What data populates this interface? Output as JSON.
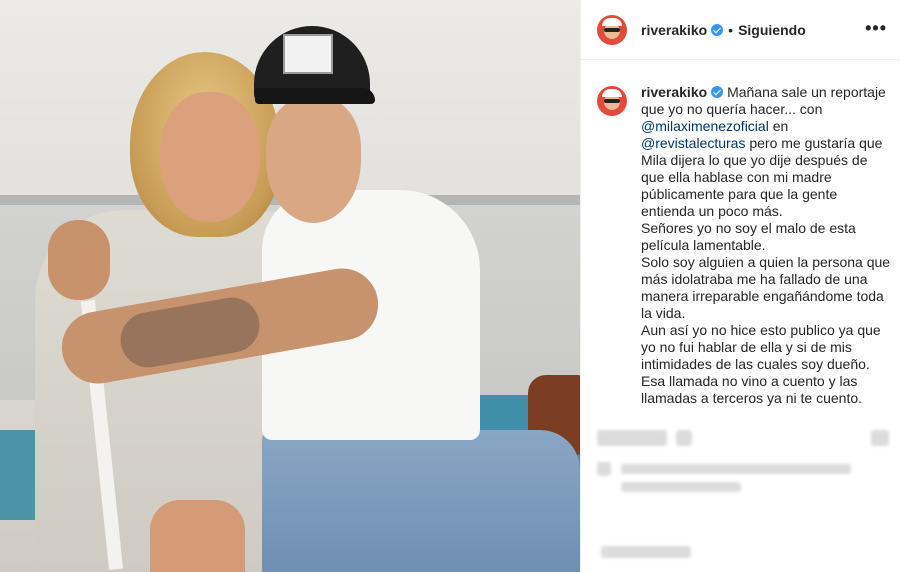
{
  "post": {
    "username": "riverakiko",
    "follow_status": "Siguiendo",
    "separator": "•",
    "more_label": "•••"
  },
  "caption": {
    "username": "riverakiko",
    "part1": "Mañana sale un reportaje que yo no quería hacer... con ",
    "mention1": "@milaximenezoficial",
    "part2": " en ",
    "mention2": "@revistalecturas",
    "part3": " pero me gustaría que Mila dijera lo que yo dije después de que ella hablase con mi madre públicamente para que la gente entienda un poco más.",
    "para2": "Señores yo no soy el malo de esta película lamentable.",
    "para3": "Solo soy alguien a quien la persona que más idolatraba me ha fallado de una manera irreparable engañándome toda la vida.",
    "para4": "Aun así yo no hice esto publico ya que yo no fui hablar de ella y si de mis intimidades de las cuales soy dueño.",
    "para5": "Esa llamada no vino a cuento y las llamadas a terceros ya ni te cuento."
  },
  "colors": {
    "mention": "#00376b",
    "verified": "#3897f0",
    "text": "#262626"
  },
  "icons": [
    "verified-badge-icon",
    "more-options-icon",
    "avatar"
  ]
}
